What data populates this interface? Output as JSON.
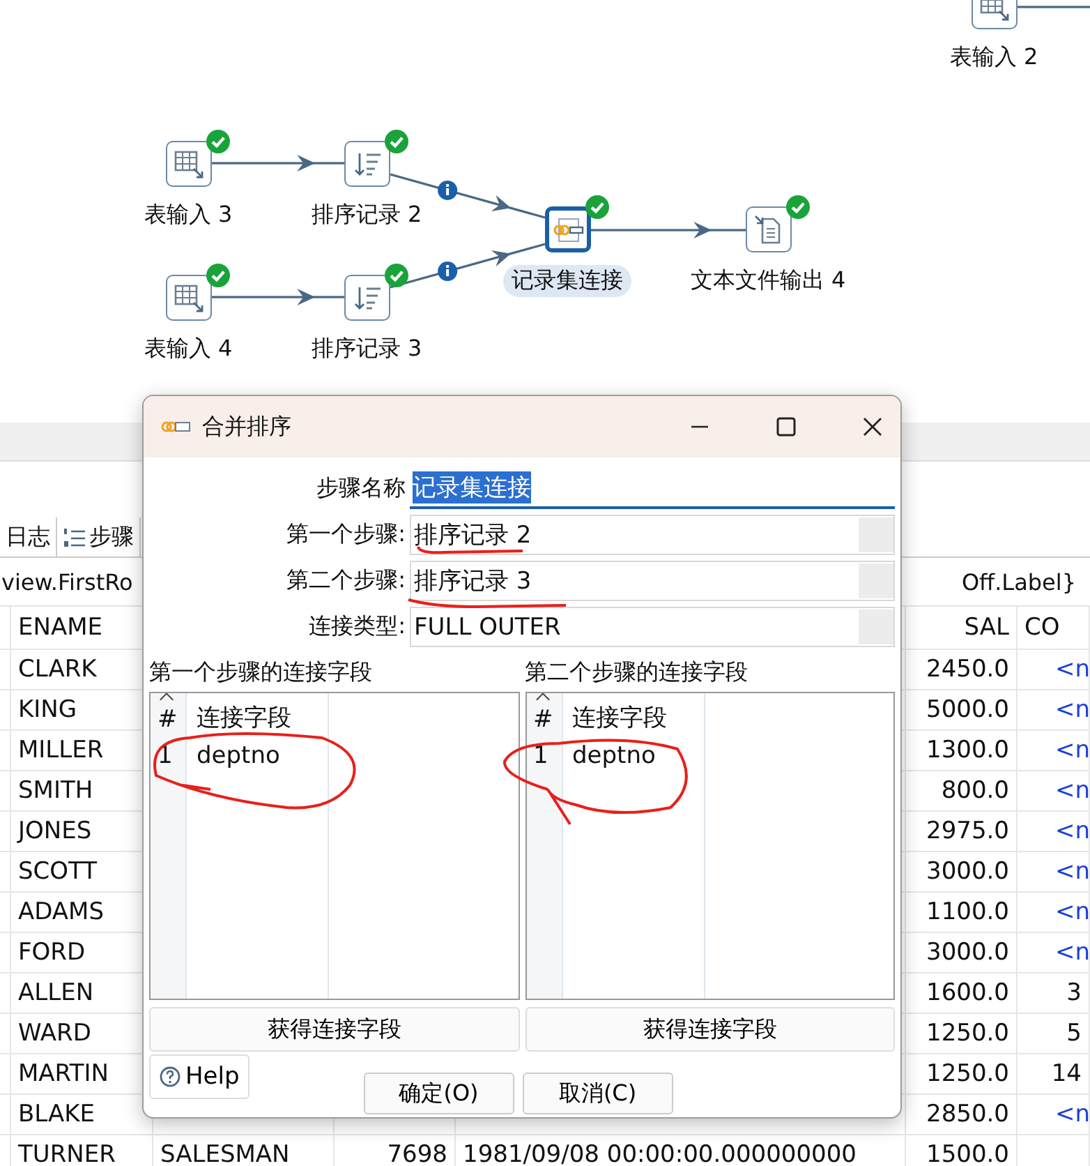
{
  "canvas": {
    "steps": [
      {
        "label": "表输入 2",
        "kind": "table-input",
        "selected": false
      },
      {
        "label": "表输入 3",
        "kind": "table-input",
        "ok": true,
        "selected": false
      },
      {
        "label": "排序记录 2",
        "kind": "sort",
        "ok": true,
        "selected": false
      },
      {
        "label": "表输入 4",
        "kind": "table-input",
        "ok": true,
        "selected": false
      },
      {
        "label": "排序记录 3",
        "kind": "sort",
        "ok": true,
        "selected": false
      },
      {
        "label": "记录集连接",
        "kind": "join",
        "ok": true,
        "selected": true
      },
      {
        "label": "文本文件输出 4",
        "kind": "text-output",
        "ok": true,
        "selected": false
      }
    ],
    "hops": [
      {
        "info": false
      },
      {
        "info": false
      },
      {
        "info": false
      },
      {
        "info": true
      },
      {
        "info": true
      },
      {
        "info": false
      }
    ]
  },
  "bottom_tabs": [
    {
      "label": "日志",
      "selected": false
    },
    {
      "label": "步骤",
      "selected": false
    }
  ],
  "toolbar_left": "view.FirstRo",
  "toolbar_right": "Off.Label}",
  "table": {
    "header": {
      "ename": "ENAME",
      "sal": "SAL",
      "comm": "CO"
    },
    "rows": [
      {
        "ename": "CLARK",
        "sal": "2450.0",
        "comm": {
          "text": "<n",
          "null": true
        }
      },
      {
        "ename": "KING",
        "sal": "5000.0",
        "comm": {
          "text": "<n",
          "null": true
        }
      },
      {
        "ename": "MILLER",
        "sal": "1300.0",
        "comm": {
          "text": "<n",
          "null": true
        }
      },
      {
        "ename": "SMITH",
        "sal": "800.0",
        "comm": {
          "text": "<n",
          "null": true
        }
      },
      {
        "ename": "JONES",
        "sal": "2975.0",
        "comm": {
          "text": "<n",
          "null": true
        }
      },
      {
        "ename": "SCOTT",
        "sal": "3000.0",
        "comm": {
          "text": "<n",
          "null": true
        }
      },
      {
        "ename": "ADAMS",
        "sal": "1100.0",
        "comm": {
          "text": "<n",
          "null": true
        }
      },
      {
        "ename": "FORD",
        "sal": "3000.0",
        "comm": {
          "text": "<n",
          "null": true
        }
      },
      {
        "ename": "ALLEN",
        "sal": "1600.0",
        "comm": {
          "text": "3",
          "null": false
        }
      },
      {
        "ename": "WARD",
        "sal": "1250.0",
        "comm": {
          "text": "5",
          "null": false
        }
      },
      {
        "ename": "MARTIN",
        "sal": "1250.0",
        "comm": {
          "text": "14",
          "null": false
        }
      },
      {
        "ename": "BLAKE",
        "sal": "2850.0",
        "comm": {
          "text": "<n",
          "null": true
        }
      },
      {
        "ename": "TURNER",
        "job": "SALESMAN",
        "mgr": "7698",
        "hiredate": "1981/09/08 00:00:00.000000000",
        "sal": "1500.0"
      }
    ]
  },
  "dialog": {
    "title": "合并排序",
    "fields": [
      {
        "label": "步骤名称",
        "value": "记录集连接",
        "kind": "text",
        "selected_text": true
      },
      {
        "label": "第一个步骤:",
        "value": "排序记录 2",
        "kind": "combo"
      },
      {
        "label": "第二个步骤:",
        "value": "排序记录 3",
        "kind": "combo"
      },
      {
        "label": "连接类型:",
        "value": "FULL OUTER",
        "kind": "combo"
      }
    ],
    "key_tables": [
      {
        "title": "第一个步骤的连接字段",
        "columns": [
          "#",
          "连接字段"
        ],
        "rows": [
          [
            "1",
            "deptno"
          ]
        ],
        "button": "获得连接字段"
      },
      {
        "title": "第二个步骤的连接字段",
        "columns": [
          "#",
          "连接字段"
        ],
        "rows": [
          [
            "1",
            "deptno"
          ]
        ],
        "button": "获得连接字段"
      }
    ],
    "help": "Help",
    "buttons": [
      "确定(O)",
      "取消(C)"
    ]
  }
}
